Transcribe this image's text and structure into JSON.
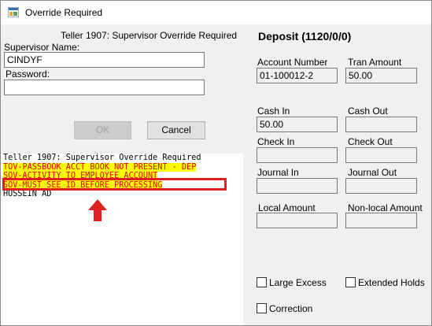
{
  "window": {
    "title": "Override Required",
    "icon": "window-app-icon"
  },
  "override": {
    "header": "Teller 1907: Supervisor Override Required",
    "supervisor_label": "Supervisor Name:",
    "supervisor_value": "CINDYF",
    "password_label": "Password:",
    "password_value": "",
    "ok_label": "OK",
    "cancel_label": "Cancel"
  },
  "log": {
    "lines": [
      "Teller 1907: Supervisor Override Required",
      "TOV-PASSBOOK ACCT BOOK NOT PRESENT - DEP",
      "SOV-ACTIVITY TO EMPLOYEE ACCOUNT",
      "SOV-MUST SEE ID BEFORE PROCESSING",
      "HUSSEIN AD"
    ],
    "highlight_color": "#ffff00",
    "text_color": "#e00000",
    "annotation_color": "#e02020"
  },
  "deposit": {
    "title": "Deposit (1120/0/0)",
    "account_number_label": "Account Number",
    "account_number_value": "01-100012-2",
    "tran_amount_label": "Tran Amount",
    "tran_amount_value": "50.00",
    "cash_in_label": "Cash In",
    "cash_in_value": "50.00",
    "cash_out_label": "Cash Out",
    "cash_out_value": "",
    "check_in_label": "Check In",
    "check_in_value": "",
    "check_out_label": "Check Out",
    "check_out_value": "",
    "journal_in_label": "Journal In",
    "journal_in_value": "",
    "journal_out_label": "Journal Out",
    "journal_out_value": "",
    "local_amount_label": "Local Amount",
    "local_amount_value": "",
    "nonlocal_amount_label": "Non-local Amount",
    "nonlocal_amount_value": "",
    "large_excess_label": "Large Excess",
    "extended_holds_label": "Extended Holds",
    "correction_label": "Correction"
  }
}
